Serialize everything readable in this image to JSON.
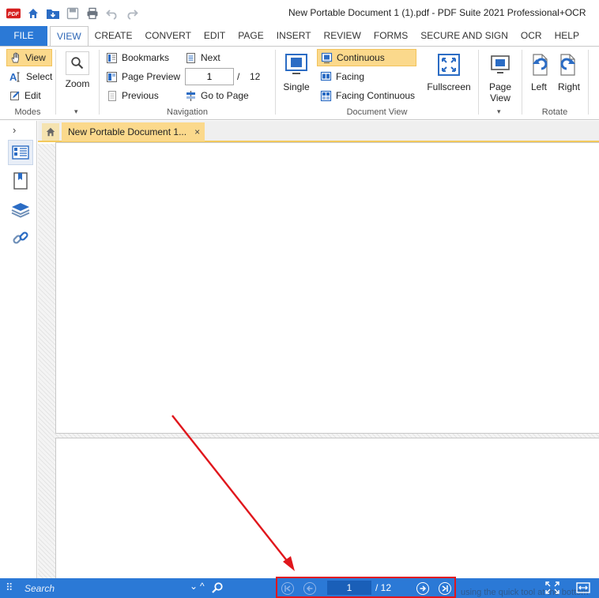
{
  "window": {
    "title": "New Portable Document 1 (1).pdf   -   PDF Suite 2021  Professional+OCR"
  },
  "quick_access": {
    "logo_text": "PDF",
    "icons": [
      "home-icon",
      "open-file-icon",
      "save-icon",
      "print-icon",
      "undo-icon",
      "redo-icon"
    ]
  },
  "tabs": [
    {
      "label": "FILE"
    },
    {
      "label": "VIEW"
    },
    {
      "label": "CREATE"
    },
    {
      "label": "CONVERT"
    },
    {
      "label": "EDIT"
    },
    {
      "label": "PAGE"
    },
    {
      "label": "INSERT"
    },
    {
      "label": "REVIEW"
    },
    {
      "label": "FORMS"
    },
    {
      "label": "SECURE AND SIGN"
    },
    {
      "label": "OCR"
    },
    {
      "label": "HELP"
    }
  ],
  "ribbon": {
    "modes": {
      "view": "View",
      "select": "Select",
      "edit": "Edit",
      "label": "Modes"
    },
    "zoom": {
      "label": "Zoom"
    },
    "navigation": {
      "bookmarks": "Bookmarks",
      "page_preview": "Page Preview",
      "previous": "Previous",
      "next": "Next",
      "go_to_page": "Go to Page",
      "current_page": "1",
      "slash": "/",
      "total_pages": "12",
      "label": "Navigation"
    },
    "document_view": {
      "single": "Single",
      "continuous": "Continuous",
      "facing": "Facing",
      "facing_continuous": "Facing Continuous",
      "fullscreen": "Fullscreen",
      "label": "Document View"
    },
    "page_view": {
      "line1": "Page",
      "line2": "View"
    },
    "rotate": {
      "left": "Left",
      "right": "Right",
      "label": "Rotate"
    }
  },
  "doc_tabs": [
    {
      "label": "New Portable Document 1...",
      "close": "×"
    }
  ],
  "statusbar": {
    "search_placeholder": "Search",
    "page_current": "1",
    "page_total": "/ 12",
    "hint": "using the quick tool at the bottom"
  },
  "colors": {
    "accent": "#2b79d6",
    "highlight": "#fbd98c",
    "annotation": "#e0161c"
  }
}
